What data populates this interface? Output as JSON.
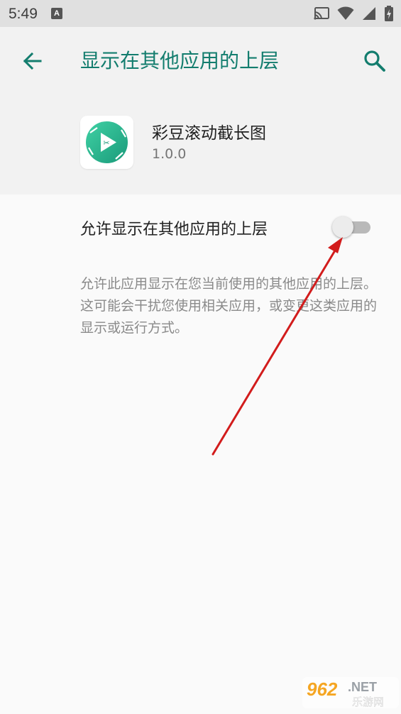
{
  "status_bar": {
    "time": "5:49",
    "notification_icon": "a-icon",
    "right_icons": [
      "cast-icon",
      "wifi-icon",
      "signal-icon",
      "battery-icon"
    ]
  },
  "header": {
    "title": "显示在其他应用的上层",
    "back_icon": "arrow-back-icon",
    "search_icon": "search-icon"
  },
  "app": {
    "name": "彩豆滚动截长图",
    "version": "1.0.0",
    "icon": "app-logo-icon"
  },
  "permission": {
    "label": "允许显示在其他应用的上层",
    "enabled": false
  },
  "description": "允许此应用显示在您当前使用的其他应用的上层。这可能会干扰您使用相关应用，或变更这类应用的显示或运行方式。",
  "watermark": {
    "brand": "962.NET",
    "subtitle": "乐游网"
  },
  "colors": {
    "accent": "#137d6e",
    "annotation_arrow": "#d21c1c",
    "header_bg": "#f2f2f2",
    "page_bg": "#fafafa"
  }
}
